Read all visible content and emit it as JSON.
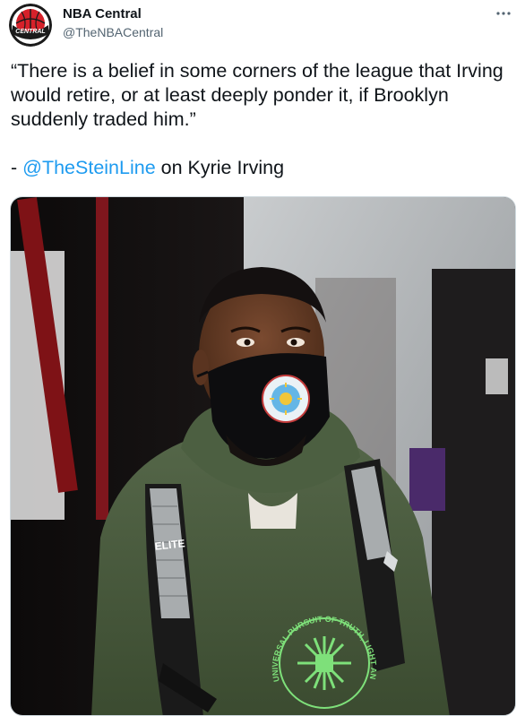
{
  "account": {
    "display_name": "NBA Central",
    "handle": "@TheNBACentral",
    "logo_text": "CENTRAL"
  },
  "tweet": {
    "quote": "“There is a belief in some corners of the league that Irving would retire, or at least deeply ponder it, if Brooklyn suddenly traded him.”",
    "attribution_prefix": "- ",
    "mention": "@TheSteinLine",
    "attribution_suffix": " on Kyrie Irving"
  },
  "photo": {
    "backpack_text": "ELITE",
    "hoodie_text": "UNIVERSAL PURSUIT OF TRUTH, LIGHT AND WISDOM"
  },
  "icons": {
    "more": "more-horizontal-icon"
  },
  "colors": {
    "link": "#1d9bf0",
    "text": "#0f1419",
    "secondary": "#536471",
    "hoodie": "#4a5d3a",
    "hoodie_print": "#7ee07a"
  }
}
